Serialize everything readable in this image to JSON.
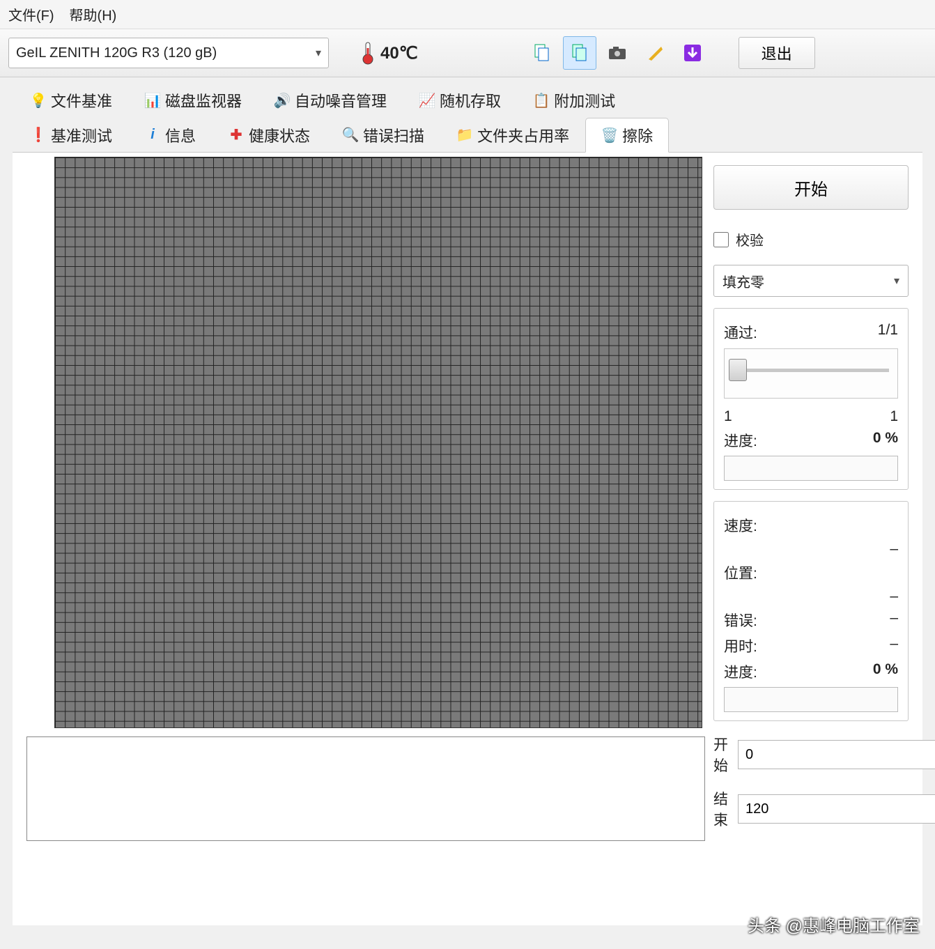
{
  "menu": {
    "file": "文件(F)",
    "help": "帮助(H)"
  },
  "toolbar": {
    "drive": "GeIL ZENITH 120G R3 (120 gB)",
    "temperature": "40℃",
    "exit": "退出"
  },
  "tabs": {
    "row1": [
      {
        "id": "file-benchmark",
        "label": "文件基准",
        "icon": "bulb"
      },
      {
        "id": "disk-monitor",
        "label": "磁盘监视器",
        "icon": "chart"
      },
      {
        "id": "aam",
        "label": "自动噪音管理",
        "icon": "sound"
      },
      {
        "id": "random-access",
        "label": "随机存取",
        "icon": "chart2"
      },
      {
        "id": "extra-tests",
        "label": "附加测试",
        "icon": "clipboard"
      }
    ],
    "row2": [
      {
        "id": "benchmark",
        "label": "基准测试",
        "icon": "exclaim"
      },
      {
        "id": "info",
        "label": "信息",
        "icon": "info"
      },
      {
        "id": "health",
        "label": "健康状态",
        "icon": "plus"
      },
      {
        "id": "error-scan",
        "label": "错误扫描",
        "icon": "search"
      },
      {
        "id": "folder-usage",
        "label": "文件夹占用率",
        "icon": "folder"
      },
      {
        "id": "erase",
        "label": "擦除",
        "icon": "trash",
        "active": true
      }
    ]
  },
  "side": {
    "start_btn": "开始",
    "verify_label": "校验",
    "method_selected": "填充零",
    "pass_label": "通过:",
    "pass_value": "1/1",
    "slider_min": "1",
    "slider_max": "1",
    "progress1_label": "进度:",
    "progress1_value": "0 %",
    "speed_label": "速度:",
    "speed_value": "–",
    "position_label": "位置:",
    "position_value": "–",
    "errors_label": "错误:",
    "errors_value": "–",
    "elapsed_label": "用时:",
    "elapsed_value": "–",
    "progress2_label": "进度:",
    "progress2_value": "0 %",
    "start_range_label": "开始",
    "start_range_value": "0",
    "end_range_label": "结束",
    "end_range_value": "120"
  },
  "watermark": "头条 @惠峰电脑工作室"
}
